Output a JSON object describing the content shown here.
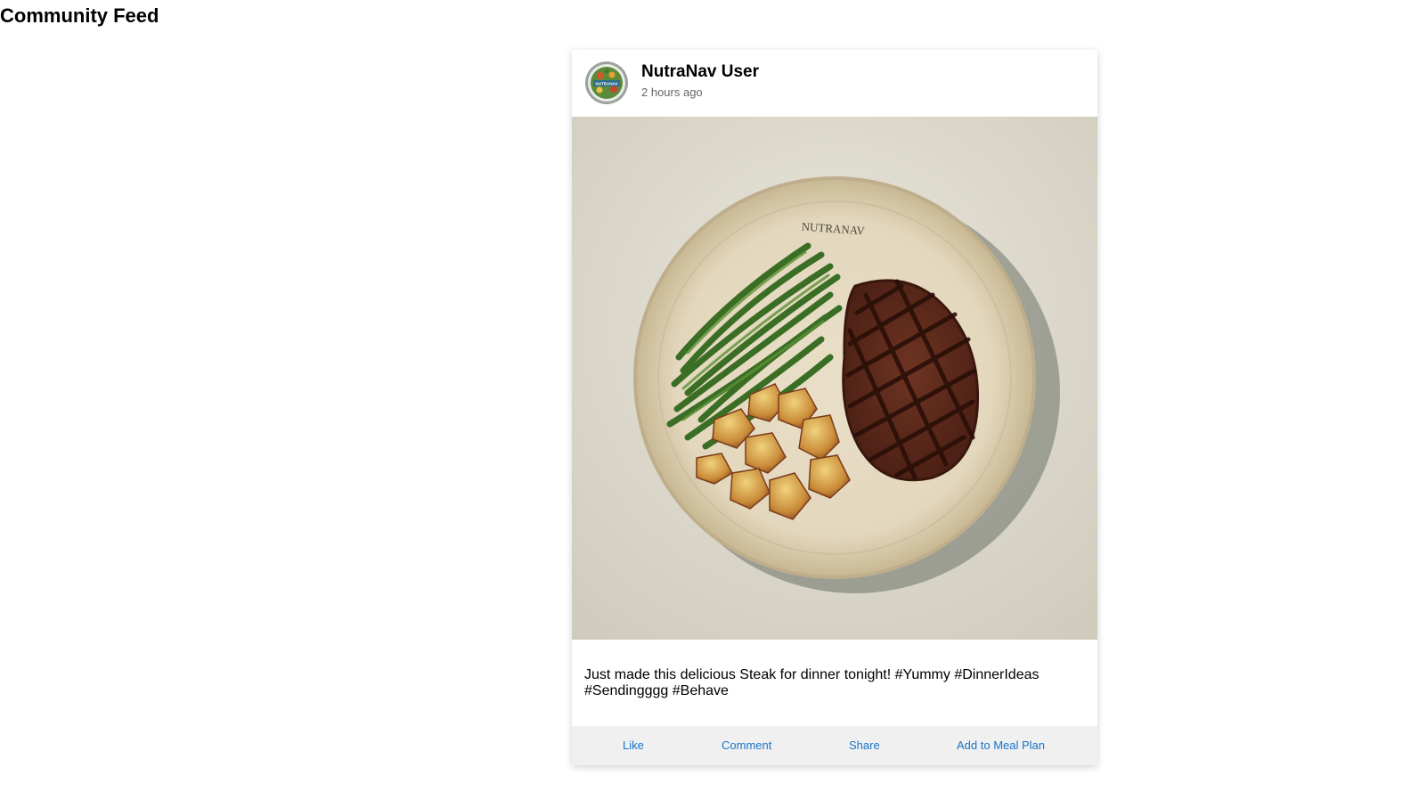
{
  "page": {
    "title": "Community Feed"
  },
  "post": {
    "username": "NutraNav User",
    "timestamp": "2 hours ago",
    "avatar_icon": "nutranav-logo-icon",
    "image_plate_brand": "NUTRANAV",
    "caption": "Just made this delicious Steak for dinner tonight! #Yummy #DinnerIdeas #Sendingggg #Behave",
    "actions": {
      "like": "Like",
      "comment": "Comment",
      "share": "Share",
      "add_to_meal_plan": "Add to Meal Plan"
    }
  },
  "colors": {
    "action_link": "#1a73c9",
    "action_bar_bg": "#f0f0f0",
    "timestamp": "#666666"
  }
}
